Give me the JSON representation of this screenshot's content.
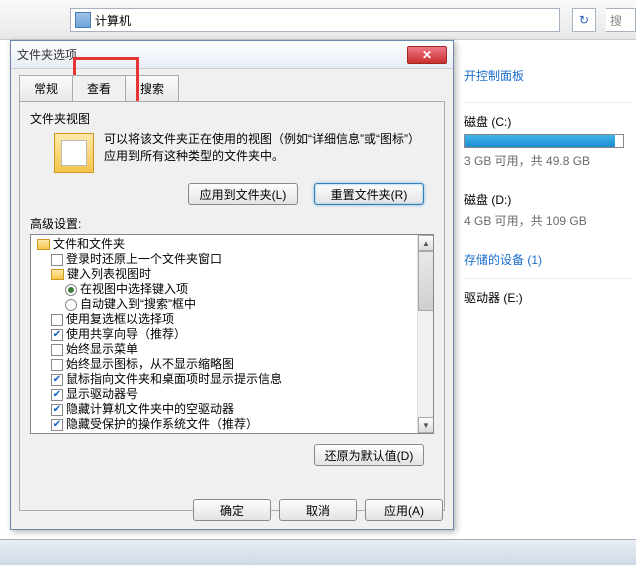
{
  "explorer": {
    "address": "计算机",
    "search_placeholder": "搜"
  },
  "right": {
    "control_panel": "开控制面板",
    "disk_c": {
      "label": "磁盘 (C:)",
      "info": "3 GB 可用，共 49.8 GB",
      "fill": 95
    },
    "disk_d": {
      "label": "磁盘 (D:)",
      "info": "4 GB 可用，共 109 GB",
      "fill": 0
    },
    "dev_header": "存储的设备 (1)",
    "drive_e": "驱动器 (E:)"
  },
  "dialog": {
    "title": "文件夹选项",
    "tabs": {
      "general": "常规",
      "view": "查看",
      "search": "搜索"
    },
    "view_section": {
      "label": "文件夹视图",
      "desc": "可以将该文件夹正在使用的视图（例如“详细信息”或“图标”）应用到所有这种类型的文件夹中。",
      "apply_btn": "应用到文件夹(L)",
      "reset_btn": "重置文件夹(R)"
    },
    "adv_label": "高级设置:",
    "tree": {
      "root": "文件和文件夹",
      "items": [
        {
          "type": "cb",
          "checked": false,
          "indent": 1,
          "label": "登录时还原上一个文件夹窗口"
        },
        {
          "type": "folder",
          "indent": 1,
          "label": "键入列表视图时"
        },
        {
          "type": "rb",
          "checked": true,
          "indent": 2,
          "label": "在视图中选择键入项"
        },
        {
          "type": "rb",
          "checked": false,
          "indent": 2,
          "label": "自动键入到“搜索”框中"
        },
        {
          "type": "cb",
          "checked": false,
          "indent": 1,
          "label": "使用复选框以选择项"
        },
        {
          "type": "cb",
          "checked": true,
          "indent": 1,
          "label": "使用共享向导（推荐）"
        },
        {
          "type": "cb",
          "checked": false,
          "indent": 1,
          "label": "始终显示菜单"
        },
        {
          "type": "cb",
          "checked": false,
          "indent": 1,
          "label": "始终显示图标，从不显示缩略图"
        },
        {
          "type": "cb",
          "checked": true,
          "indent": 1,
          "label": "鼠标指向文件夹和桌面项时显示提示信息"
        },
        {
          "type": "cb",
          "checked": true,
          "indent": 1,
          "label": "显示驱动器号"
        },
        {
          "type": "cb",
          "checked": true,
          "indent": 1,
          "label": "隐藏计算机文件夹中的空驱动器"
        },
        {
          "type": "cb",
          "checked": true,
          "indent": 1,
          "label": "隐藏受保护的操作系统文件（推荐）"
        }
      ]
    },
    "restore_btn": "还原为默认值(D)",
    "footer": {
      "ok": "确定",
      "cancel": "取消",
      "apply": "应用(A)"
    }
  }
}
